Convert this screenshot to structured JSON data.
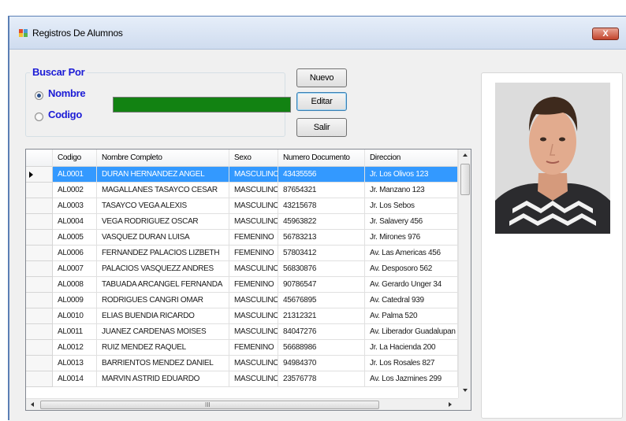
{
  "window": {
    "title": "Registros De Alumnos",
    "close_label": "X"
  },
  "search": {
    "group_label": "Buscar Por",
    "option_nombre": "Nombre",
    "option_codigo": "Codigo",
    "selected_option": "Nombre",
    "input_value": ""
  },
  "buttons": {
    "nuevo": "Nuevo",
    "editar": "Editar",
    "salir": "Salir"
  },
  "grid": {
    "columns": [
      "Codigo",
      "Nombre Completo",
      "Sexo",
      "Numero Documento",
      "Direccion"
    ],
    "selected_row": 0,
    "rows": [
      [
        "AL0001",
        "DURAN HERNANDEZ ANGEL",
        "MASCULINO",
        "43435556",
        "Jr. Los Olivos 123"
      ],
      [
        "AL0002",
        "MAGALLANES TASAYCO CESAR",
        "MASCULINO",
        "87654321",
        "Jr. Manzano 123"
      ],
      [
        "AL0003",
        "TASAYCO VEGA ALEXIS",
        "MASCULINO",
        "43215678",
        "Jr. Los Sebos"
      ],
      [
        "AL0004",
        "VEGA RODRIGUEZ OSCAR",
        "MASCULINO",
        "45963822",
        "Jr. Salavery 456"
      ],
      [
        "AL0005",
        "VASQUEZ DURAN LUISA",
        "FEMENINO",
        "56783213",
        "Jr. Mirones 976"
      ],
      [
        "AL0006",
        "FERNANDEZ PALACIOS LIZBETH",
        "FEMENINO",
        "57803412",
        "Av. Las Americas 456"
      ],
      [
        "AL0007",
        "PALACIOS VASQUEZZ ANDRES",
        "MASCULINO",
        "56830876",
        "Av. Desposoro 562"
      ],
      [
        "AL0008",
        "TABUADA ARCANGEL FERNANDA",
        "FEMENINO",
        "90786547",
        "Av. Gerardo Unger 34"
      ],
      [
        "AL0009",
        "RODRIGUES CANGRI OMAR",
        "MASCULINO",
        "45676895",
        "Av. Catedral 939"
      ],
      [
        "AL0010",
        "ELIAS BUENDIA RICARDO",
        "MASCULINO",
        "21312321",
        "Av. Palma 520"
      ],
      [
        "AL0011",
        "JUANEZ CARDENAS MOISES",
        "MASCULINO",
        "84047276",
        "Av. Liberador Guadalupan"
      ],
      [
        "AL0012",
        "RUIZ MENDEZ RAQUEL",
        "FEMENINO",
        "56688986",
        "Jr. La Hacienda 200"
      ],
      [
        "AL0013",
        "BARRIENTOS MENDEZ DANIEL",
        "MASCULINO",
        "94984370",
        "Jr. Los Rosales 827"
      ],
      [
        "AL0014",
        "MARVIN ASTRID EDUARDO",
        "MASCULINO",
        "23576778",
        "Av. Los Jazmines 299"
      ]
    ],
    "hscroll_grip": "III"
  },
  "colors": {
    "accent_label": "#1c1cd6",
    "search_input_bg": "#128212",
    "selection": "#3399ff"
  }
}
